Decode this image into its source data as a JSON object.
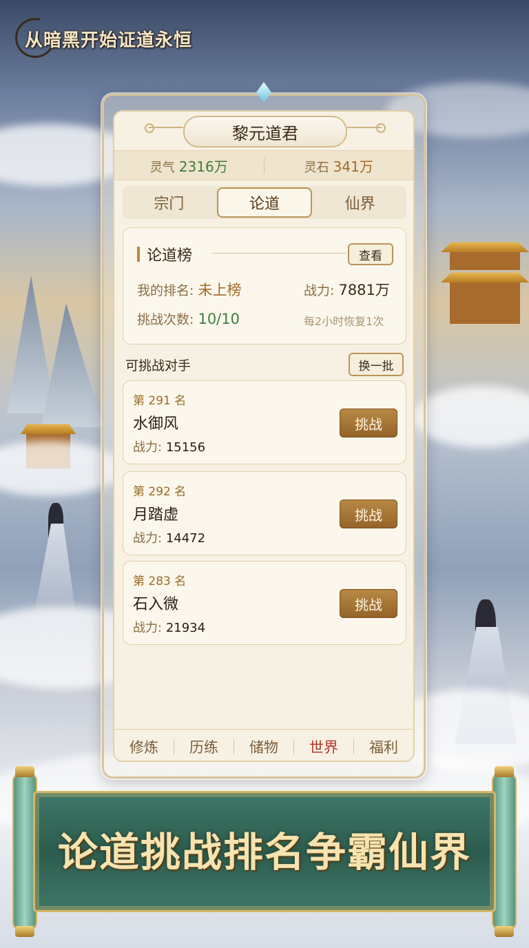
{
  "logo": {
    "title": "从暗黑开始证道永恒"
  },
  "panel": {
    "title": "黎元道君",
    "resources": [
      {
        "label": "灵气",
        "value": "2316万"
      },
      {
        "label": "灵石",
        "value": "341万"
      }
    ],
    "tabs": [
      {
        "label": "宗门",
        "active": false
      },
      {
        "label": "论道",
        "active": true
      },
      {
        "label": "仙界",
        "active": false
      }
    ],
    "ranking": {
      "title": "论道榜",
      "view_label": "查看",
      "my_rank_label": "我的排名:",
      "my_rank_value": "未上榜",
      "power_label": "战力:",
      "power_value": "7881万",
      "attempts_label": "挑战次数:",
      "attempts_value": "10/10",
      "recover_note": "每2小时恢复1次"
    },
    "opponents_header": "可挑战对手",
    "refresh_label": "换一批",
    "opponents": [
      {
        "rank": "第 291 名",
        "name": "水御风",
        "power_label": "战力:",
        "power": "15156",
        "action": "挑战"
      },
      {
        "rank": "第 292 名",
        "name": "月踏虚",
        "power_label": "战力:",
        "power": "14472",
        "action": "挑战"
      },
      {
        "rank": "第 283 名",
        "name": "石入微",
        "power_label": "战力:",
        "power": "21934",
        "action": "挑战"
      }
    ],
    "nav": [
      {
        "label": "修炼",
        "active": false
      },
      {
        "label": "历练",
        "active": false
      },
      {
        "label": "储物",
        "active": false
      },
      {
        "label": "世界",
        "active": true
      },
      {
        "label": "福利",
        "active": false
      }
    ]
  },
  "banner": {
    "slogan": "论道挑战排名争霸仙界"
  },
  "colors": {
    "accent_gold": "#b88a45",
    "active_red": "#b8352a",
    "jade": "#3f7868"
  }
}
